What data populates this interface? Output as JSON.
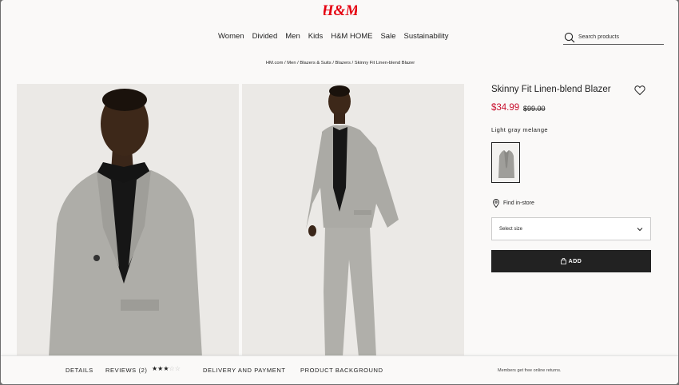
{
  "brand": {
    "logo_text": "H&M",
    "color": "#e50010"
  },
  "nav": {
    "items": [
      {
        "label": "Women"
      },
      {
        "label": "Divided"
      },
      {
        "label": "Men"
      },
      {
        "label": "Kids"
      },
      {
        "label": "H&M HOME"
      },
      {
        "label": "Sale"
      },
      {
        "label": "Sustainability"
      }
    ]
  },
  "search": {
    "placeholder": "Search products",
    "icon": "search-icon"
  },
  "breadcrumb": {
    "items": [
      "HM.com",
      "Men",
      "Blazers & Suits",
      "Blazers",
      "Skinny Fit Linen-blend Blazer"
    ],
    "separator": " / "
  },
  "product": {
    "title": "Skinny Fit Linen-blend Blazer",
    "price": "$34.99",
    "old_price": "$99.00",
    "price_color": "#c8102e",
    "color_name": "Light gray melange",
    "find_in_store": "Find in-store",
    "size_select": "Select size",
    "add_label": "ADD"
  },
  "bottom_bar": {
    "tabs": {
      "details": "DETAILS",
      "reviews": "REVIEWS (2)",
      "delivery": "DELIVERY AND PAYMENT",
      "background": "PRODUCT BACKGROUND"
    },
    "rating": {
      "value": 3,
      "max": 5,
      "filled": "★★★",
      "empty": "☆☆"
    },
    "returns_note": "Members get free online returns."
  }
}
